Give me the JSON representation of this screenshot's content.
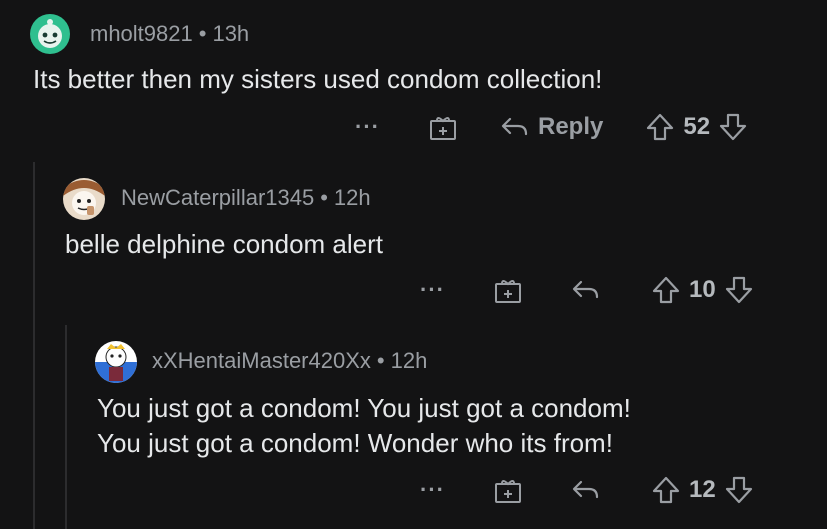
{
  "comments": [
    {
      "username": "mholt9821",
      "separator": "•",
      "time": "13h",
      "lines": [
        "Its better then my sisters used condom collection!"
      ],
      "more": "···",
      "reply_label": "Reply",
      "votes": "52"
    },
    {
      "username": "NewCaterpillar1345",
      "separator": "•",
      "time": "12h",
      "lines": [
        "belle delphine condom alert"
      ],
      "more": "···",
      "votes": "10"
    },
    {
      "username": "xXHentaiMaster420Xx",
      "separator": "•",
      "time": "12h",
      "lines": [
        "You just got a condom! You just got a condom!",
        "You just got a condom! Wonder who its from!"
      ],
      "more": "···",
      "votes": "12"
    }
  ],
  "colors": {
    "background": "#131314",
    "text": "#e6e8ea",
    "muted": "#9a9ea3",
    "avatar1": "#2fbf8f"
  }
}
